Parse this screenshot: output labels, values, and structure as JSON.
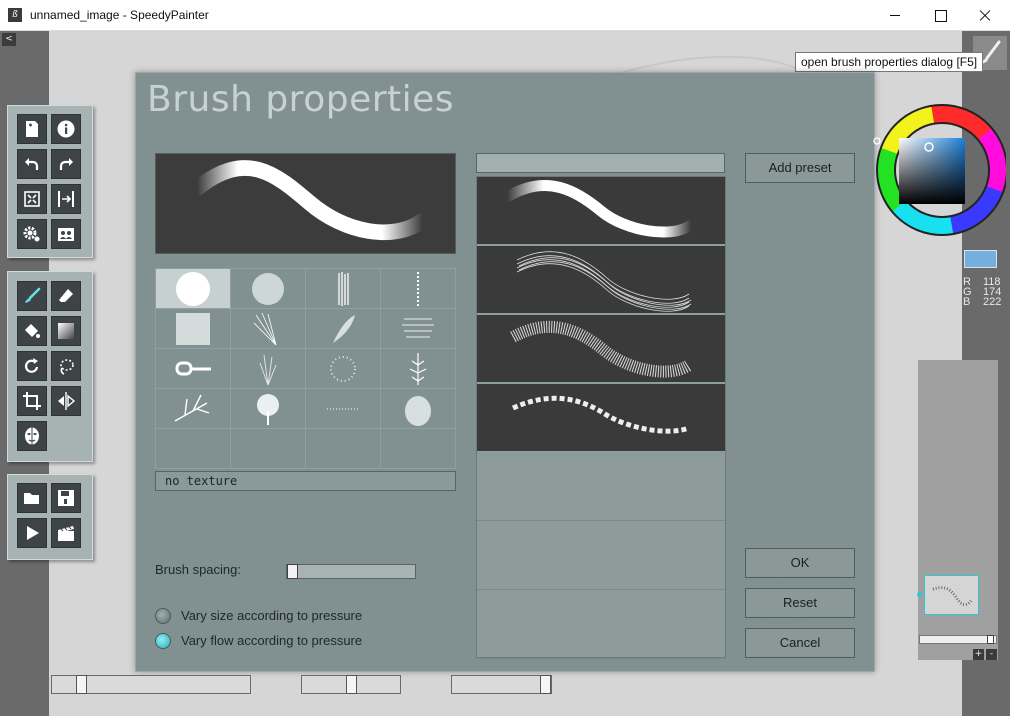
{
  "window": {
    "title": "unnamed_image - SpeedyPainter",
    "icon_name": "speedypainter-logo-icon",
    "app_icon_glyph": "ß",
    "controls": [
      "minimize-icon",
      "maximize-icon",
      "close-icon"
    ]
  },
  "collapse_toggle": "<",
  "tooltip": "open brush properties dialog [F5]",
  "toolbar": {
    "group1": [
      "new-document-icon",
      "info-icon",
      "undo-icon",
      "redo-icon",
      "canvas-size-icon",
      "mirror-view-icon",
      "settings-icon",
      "layers-icon"
    ],
    "group2": [
      "brush-icon",
      "eraser-icon",
      "fill-bucket-icon",
      "gradient-icon",
      "rotate-icon",
      "lasso-icon",
      "crop-icon",
      "flip-icon",
      "mask-icon"
    ],
    "group3": [
      "open-file-icon",
      "save-icon",
      "play-icon",
      "clapperboard-icon"
    ]
  },
  "dialog": {
    "title": "Brush properties",
    "texture_label": "no texture",
    "textures": [
      "round",
      "noise-dots",
      "vertical-scratch",
      "dotted-line",
      "rough-square",
      "fan-lines",
      "feather",
      "horizontal-scratch",
      "chain",
      "grass",
      "speckle",
      "pine",
      "branch",
      "tree",
      "splatter",
      "bush",
      "empty",
      "empty",
      "empty",
      "empty"
    ],
    "spacing_label": "Brush spacing:",
    "spacing_value": 0.0,
    "vary_size_label": "Vary size according to pressure",
    "vary_flow_label": "Vary flow according to pressure",
    "vary_size_checked": false,
    "vary_flow_checked": true,
    "presets": [
      "soft-round",
      "hair-lines",
      "grainy",
      "chain",
      "empty",
      "empty",
      "empty"
    ],
    "add_preset_label": "Add preset",
    "ok_label": "OK",
    "reset_label": "Reset",
    "cancel_label": "Cancel"
  },
  "color": {
    "hex": "#76aede",
    "r_label": "R",
    "g_label": "G",
    "b_label": "B",
    "r": "118",
    "g": "174",
    "b": "222"
  },
  "navigator": {
    "plus_label": "+",
    "minus_label": "-"
  },
  "colors": {
    "accent": "#2ec6d4",
    "dialog_bg": "#7d8e8e"
  }
}
